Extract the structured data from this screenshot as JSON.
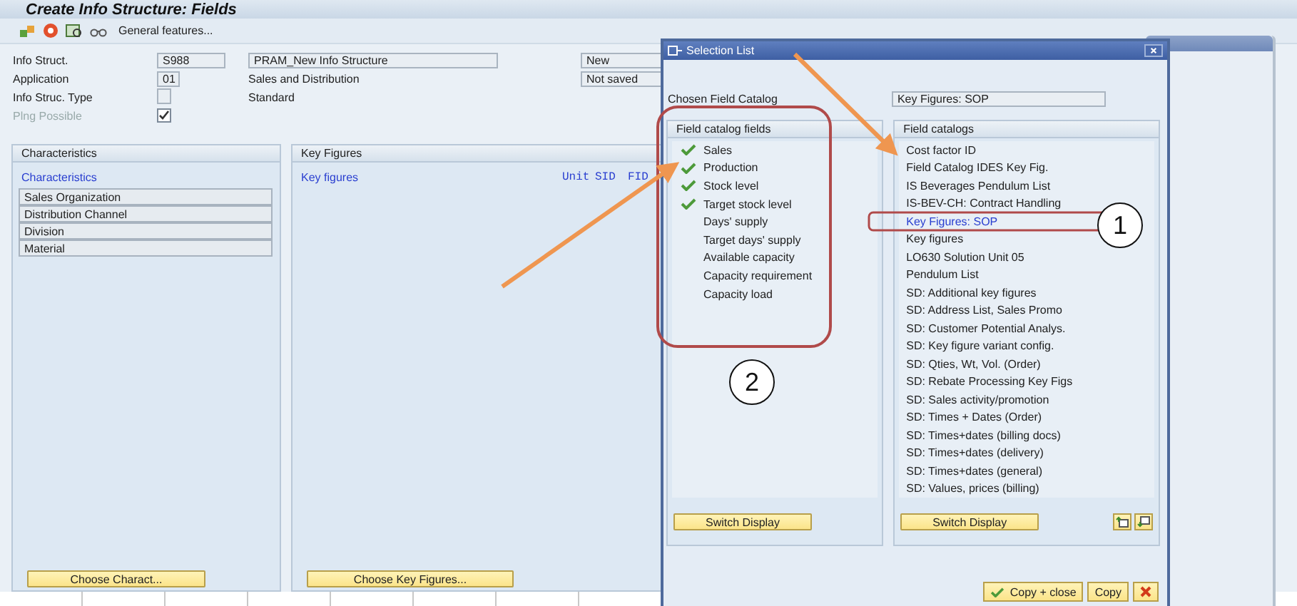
{
  "window": {
    "title": "Create Info Structure: Fields"
  },
  "toolbar": {
    "button_label": "General features..."
  },
  "header_rows": [
    {
      "label": "Info Struct.",
      "code": "S988",
      "description": "PRAM_New Info Structure",
      "description_boxed": true,
      "status": "New"
    },
    {
      "label": "Application",
      "code": "01",
      "description": "Sales and Distribution",
      "description_boxed": false,
      "status": "Not saved"
    },
    {
      "label": "Info Struc. Type",
      "description": "Standard",
      "description_boxed": false
    }
  ],
  "planning": {
    "label": "Plng Possible",
    "checked": true,
    "disabled": true
  },
  "characteristics": {
    "title": "Characteristics",
    "heading": "Characteristics",
    "items": [
      "Sales Organization",
      "Distribution Channel",
      "Division",
      "Material"
    ],
    "button": "Choose Charact..."
  },
  "key_figures": {
    "title": "Key Figures",
    "heading": "Key figures",
    "columns": [
      "Unit",
      "SID",
      "FID"
    ],
    "button": "Choose Key Figures..."
  },
  "dialog": {
    "title": "Selection List",
    "chosen_label": "Chosen Field Catalog",
    "chosen_value": "Key Figures: SOP",
    "fields_panel": {
      "title": "Field catalog fields",
      "button": "Switch Display",
      "items": [
        {
          "label": "Sales",
          "checked": true
        },
        {
          "label": "Production",
          "checked": true
        },
        {
          "label": "Stock level",
          "checked": true
        },
        {
          "label": "Target stock level",
          "checked": true
        },
        {
          "label": "Days' supply",
          "checked": false
        },
        {
          "label": "Target days' supply",
          "checked": false
        },
        {
          "label": "Available capacity",
          "checked": false
        },
        {
          "label": "Capacity requirement",
          "checked": false
        },
        {
          "label": "Capacity load",
          "checked": false
        }
      ]
    },
    "catalogs_panel": {
      "title": "Field catalogs",
      "button": "Switch Display",
      "items": [
        {
          "label": "Cost factor ID",
          "selected": false
        },
        {
          "label": "Field Catalog IDES Key Fig.",
          "selected": false
        },
        {
          "label": "IS Beverages Pendulum List",
          "selected": false
        },
        {
          "label": "IS-BEV-CH: Contract Handling",
          "selected": false
        },
        {
          "label": "Key Figures: SOP",
          "selected": true
        },
        {
          "label": "Key figures",
          "selected": false
        },
        {
          "label": "LO630 Solution Unit 05",
          "selected": false
        },
        {
          "label": "Pendulum List",
          "selected": false
        },
        {
          "label": "SD: Additional key figures",
          "selected": false
        },
        {
          "label": "SD: Address List, Sales Promo",
          "selected": false
        },
        {
          "label": "SD: Customer Potential Analys.",
          "selected": false
        },
        {
          "label": "SD: Key figure variant config.",
          "selected": false
        },
        {
          "label": "SD: Qties, Wt, Vol. (Order)",
          "selected": false
        },
        {
          "label": "SD: Rebate Processing Key Figs",
          "selected": false
        },
        {
          "label": "SD: Sales activity/promotion",
          "selected": false
        },
        {
          "label": "SD: Times + Dates (Order)",
          "selected": false
        },
        {
          "label": "SD: Times+dates (billing docs)",
          "selected": false
        },
        {
          "label": "SD: Times+dates (delivery)",
          "selected": false
        },
        {
          "label": "SD: Times+dates (general)",
          "selected": false
        },
        {
          "label": "SD: Values, prices (billing)",
          "selected": false
        }
      ]
    },
    "buttons": [
      {
        "kind": "confirm",
        "label": "Copy + close"
      },
      {
        "kind": "plain",
        "label": "Copy"
      },
      {
        "kind": "cancel"
      }
    ]
  },
  "callouts": [
    "1",
    "2"
  ]
}
